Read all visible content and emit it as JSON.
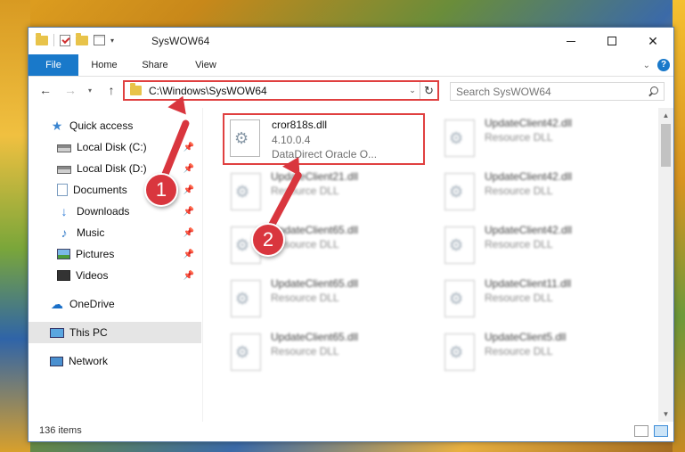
{
  "window": {
    "title": "SysWOW64"
  },
  "ribbon": {
    "tabs": [
      {
        "label": "File"
      },
      {
        "label": "Home"
      },
      {
        "label": "Share"
      },
      {
        "label": "View"
      }
    ]
  },
  "navigation": {
    "address": "C:\\Windows\\SysWOW64",
    "search_placeholder": "Search SysWOW64"
  },
  "sidebar": {
    "items": [
      {
        "label": "Quick access",
        "icon": "star-icon",
        "pinned": false
      },
      {
        "label": "Local Disk (C:)",
        "icon": "drive-icon",
        "pinned": true
      },
      {
        "label": "Local Disk (D:)",
        "icon": "drive-icon",
        "pinned": true
      },
      {
        "label": "Documents",
        "icon": "documents-icon",
        "pinned": true
      },
      {
        "label": "Downloads",
        "icon": "downloads-icon",
        "pinned": true
      },
      {
        "label": "Music",
        "icon": "music-icon",
        "pinned": true
      },
      {
        "label": "Pictures",
        "icon": "pictures-icon",
        "pinned": true
      },
      {
        "label": "Videos",
        "icon": "videos-icon",
        "pinned": true
      },
      {
        "label": "OneDrive",
        "icon": "onedrive-icon",
        "pinned": false
      },
      {
        "label": "This PC",
        "icon": "this-pc-icon",
        "pinned": false,
        "selected": true
      },
      {
        "label": "Network",
        "icon": "network-icon",
        "pinned": false
      }
    ]
  },
  "files": [
    {
      "name": "cror818s.dll",
      "line2": "4.10.0.4",
      "line3": "DataDirect Oracle O..."
    },
    {
      "name": "UpdateClient42.dll",
      "line2": "Resource DLL"
    },
    {
      "name": "UpdateClient21.dll",
      "line2": "Resource DLL"
    },
    {
      "name": "UpdateClient42.dll",
      "line2": "Resource DLL"
    },
    {
      "name": "UpdateClient65.dll",
      "line2": "Resource DLL"
    },
    {
      "name": "UpdateClient42.dll",
      "line2": "Resource DLL"
    },
    {
      "name": "UpdateClient65.dll",
      "line2": "Resource DLL"
    },
    {
      "name": "UpdateClient11.dll",
      "line2": "Resource DLL"
    },
    {
      "name": "UpdateClient65.dll",
      "line2": "Resource DLL"
    },
    {
      "name": "UpdateClient5.dll",
      "line2": "Resource DLL"
    }
  ],
  "status": {
    "item_count": "136 items"
  },
  "annotations": {
    "badge1": "1",
    "badge2": "2"
  },
  "colors": {
    "accent": "#1979ca",
    "annotation": "#d9363e"
  }
}
